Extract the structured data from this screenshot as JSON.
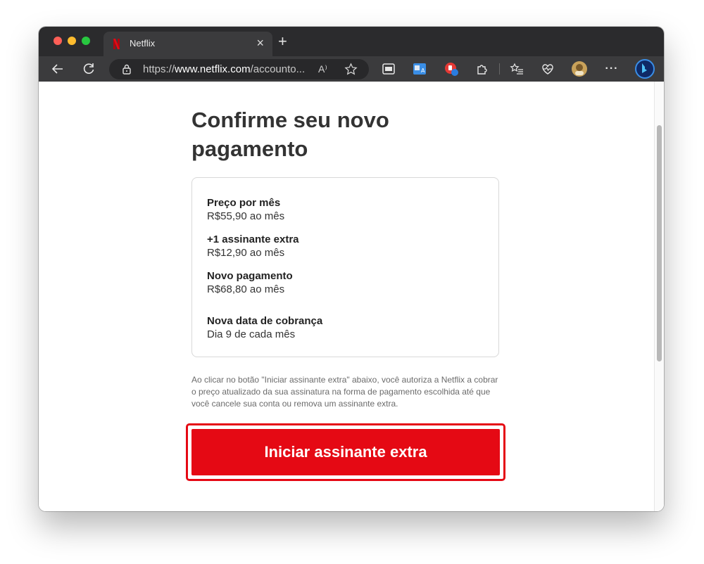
{
  "browser": {
    "tab_title": "Netflix",
    "tab_close": "×",
    "new_tab": "+",
    "url_prefix": "https://",
    "url_host": "www.netflix.com",
    "url_path": "/accounto...",
    "read_aloud_label": "A⁾"
  },
  "page": {
    "heading": "Confirme seu novo pagamento",
    "summary": [
      {
        "label": "Preço por mês",
        "value": "R$55,90 ao mês"
      },
      {
        "label": "+1 assinante extra",
        "value": "R$12,90 ao mês"
      },
      {
        "label": "Novo pagamento",
        "value": "R$68,80 ao mês"
      },
      {
        "label": "Nova data de cobrança",
        "value": "Dia 9 de cada mês"
      }
    ],
    "consent_text": "Ao clicar no botão \"Iniciar assinante extra\" abaixo, você autoriza a Netflix a cobrar o preço atualizado da sua assinatura na forma de pagamento escolhida até que você cancele sua conta ou remova um assinante extra.",
    "cta_label": "Iniciar assinante extra"
  },
  "colors": {
    "netflix_red": "#e50914",
    "titlebar": "#2b2b2d",
    "toolbar": "#3b3b3d"
  }
}
